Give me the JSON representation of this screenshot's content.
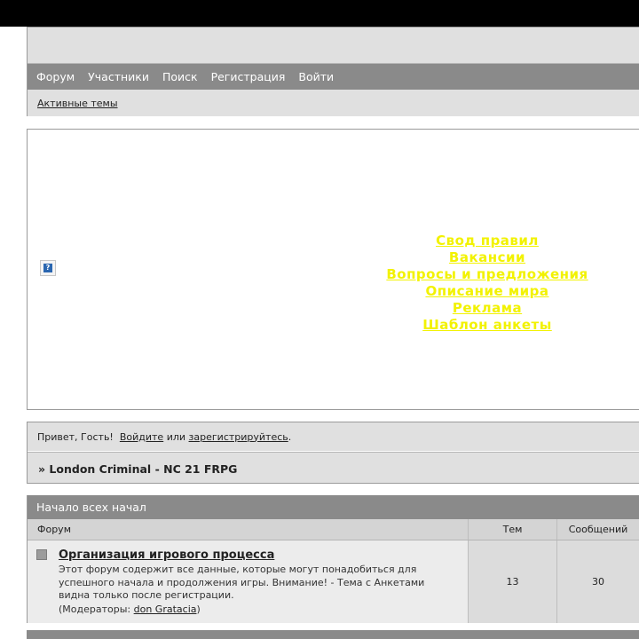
{
  "nav": {
    "items": [
      "Форум",
      "Участники",
      "Поиск",
      "Регистрация",
      "Войти"
    ],
    "active_topics": "Активные темы"
  },
  "banner": {
    "help_icon": "question-icon",
    "links": [
      "Свод правил",
      "Вакансии",
      "Вопросы и предложения",
      "Описание мира",
      "Реклама",
      "Шаблон анкеты"
    ],
    "link_color": "#f2f200"
  },
  "guest": {
    "greeting": "Привет, Гость!",
    "login": "Войдите",
    "or": "или",
    "register": "зарегистрируйтесь",
    "dot": "."
  },
  "breadcrumb": "» London Criminal - NC 21 FRPG",
  "category": {
    "title": "Начало всех начал",
    "columns": [
      "Форум",
      "Тем",
      "Сообщений"
    ],
    "forums": [
      {
        "title": "Организация игрового процесса",
        "description": "Этот форум содержит все данные, которые могут понадобиться для успешного начала и продолжения игры. Внимание! - Тема с Анкетами видна только после регистрации.",
        "moderators_prefix": "(Модераторы: ",
        "moderator": "don Gratacia",
        "moderators_suffix": ")",
        "topics": "13",
        "posts": "30"
      }
    ]
  }
}
